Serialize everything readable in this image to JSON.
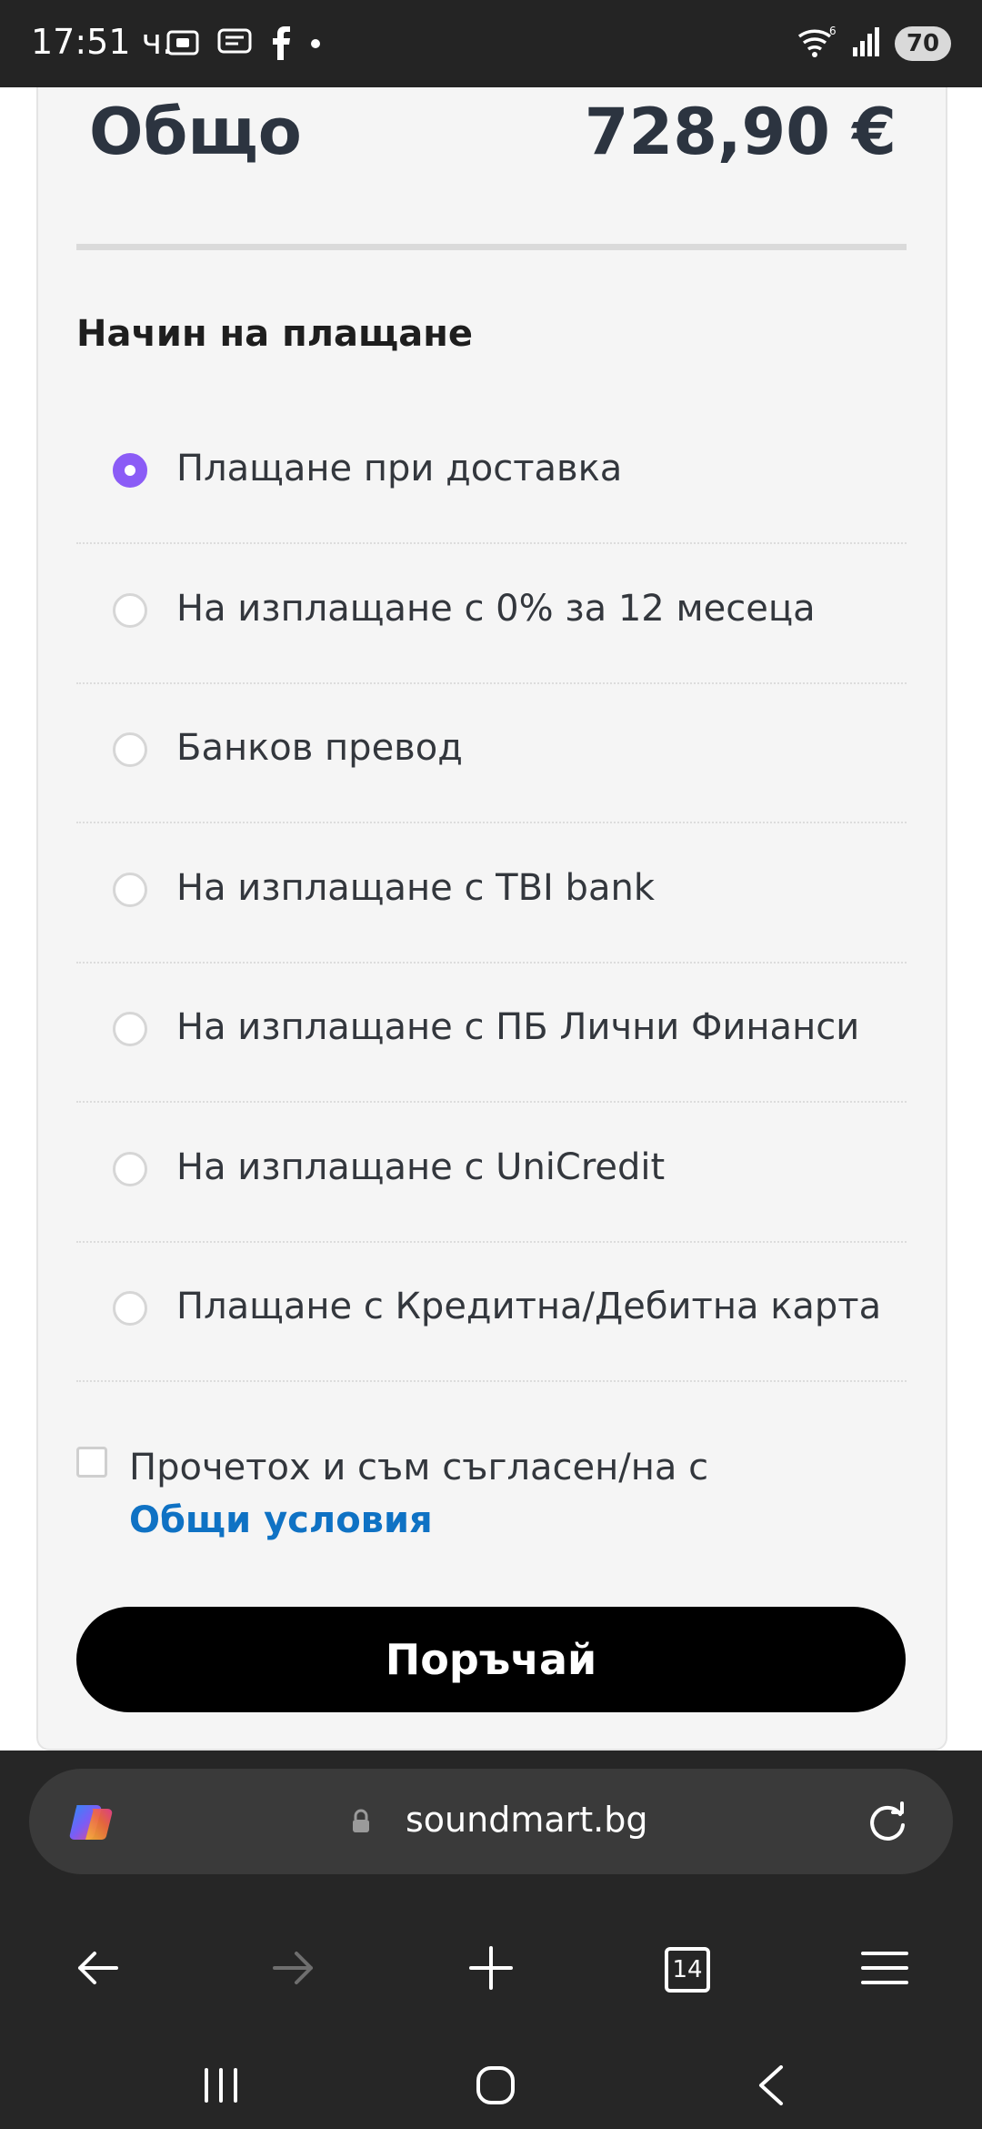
{
  "status_bar": {
    "time": "17:51 ч.",
    "battery": "70",
    "icons": [
      "screenshot-icon",
      "message-icon",
      "facebook-icon",
      "dot-icon",
      "wifi-icon",
      "signal-icon"
    ]
  },
  "order_summary": {
    "total_label": "Общо",
    "total_value": "728,90 €"
  },
  "payment": {
    "title": "Начин на плащане",
    "options": [
      {
        "label": "Плащане при доставка",
        "selected": true
      },
      {
        "label": "На изплащане с 0% за 12 месеца",
        "selected": false
      },
      {
        "label": "Банков превод",
        "selected": false
      },
      {
        "label": "На изплащане с TBI bank",
        "selected": false
      },
      {
        "label": "На изплащане с ПБ Лични Финанси",
        "selected": false
      },
      {
        "label": "На изплащане с UniCredit",
        "selected": false
      },
      {
        "label": "Плащане с Кредитна/Дебитна карта",
        "selected": false
      }
    ]
  },
  "terms": {
    "text": "Прочетох и съм съгласен/на с ",
    "link": "Общи условия",
    "checked": false
  },
  "order_button": {
    "label": "Поръчай"
  },
  "browser": {
    "url": "soundmart.bg",
    "tabs_count": "14"
  },
  "colors": {
    "accent_radio": "#8b5cf6",
    "link": "#0f72c4",
    "button": "#000000"
  }
}
